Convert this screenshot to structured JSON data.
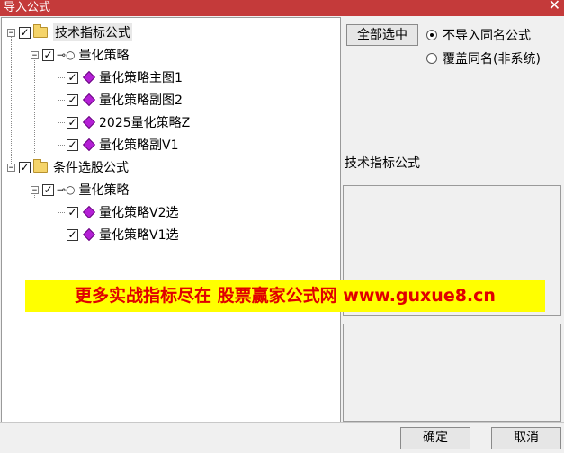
{
  "window": {
    "title": "导入公式",
    "close_glyph": "✕"
  },
  "tree": {
    "groups": [
      {
        "label": "技术指标公式",
        "checked": true,
        "strategy": {
          "label": "量化策略",
          "items": [
            "量化策略主图1",
            "量化策略副图2",
            "2025量化策略Z",
            "量化策略副V1"
          ]
        }
      },
      {
        "label": "条件选股公式",
        "checked": true,
        "strategy": {
          "label": "量化策略",
          "items": [
            "量化策略V2选",
            "量化策略V1选"
          ]
        }
      }
    ]
  },
  "options": {
    "select_all_label": "全部选中",
    "radio_skip_label": "不导入同名公式",
    "radio_overwrite_label": "覆盖同名(非系统)",
    "selected_radio": "skip"
  },
  "side_panel": {
    "selected_type": "技术指标公式"
  },
  "banner": {
    "text": "更多实战指标尽在 股票赢家公式网 www.guxue8.cn"
  },
  "footer": {
    "ok_label": "确定",
    "cancel_label": "取消"
  }
}
